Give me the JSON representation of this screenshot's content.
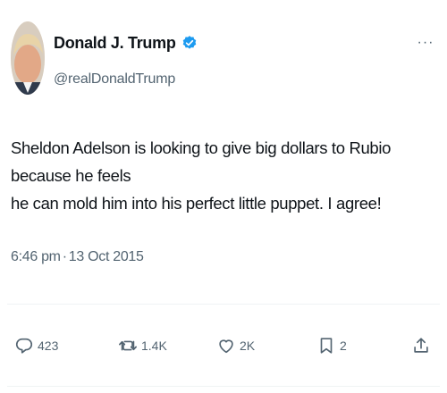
{
  "user": {
    "display_name": "Donald J. Trump",
    "handle": "@realDonaldTrump",
    "verified": true
  },
  "tweet": {
    "text_line1": "Sheldon Adelson is looking to give big dollars to Rubio because he feels",
    "text_line2": "he can mold him into his perfect little puppet. I agree!",
    "time": "6:46 pm",
    "separator": "·",
    "date": "13 Oct 2015"
  },
  "actions": {
    "replies": "423",
    "retweets": "1.4K",
    "likes": "2K",
    "bookmarks": "2"
  },
  "more_label": "···",
  "colors": {
    "text": "#0f1419",
    "secondary": "#536471",
    "verified_badge": "#1d9bf0"
  }
}
